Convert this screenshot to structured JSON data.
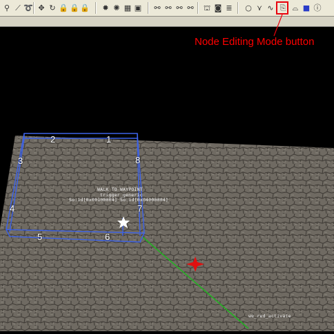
{
  "toolbar": {
    "buttons": [
      {
        "icon": "select-icon",
        "glyph": "⚲"
      },
      {
        "icon": "wand-icon",
        "glyph": "⟋"
      },
      {
        "icon": "lasso-icon",
        "glyph": "➰"
      },
      {
        "icon": "move-icon",
        "glyph": "✥"
      },
      {
        "icon": "rotate-icon",
        "glyph": "↻"
      },
      {
        "icon": "lock-icon",
        "glyph": "🔒"
      },
      {
        "icon": "lock-2-icon",
        "glyph": "🔒"
      },
      {
        "icon": "lock-3-icon",
        "glyph": "🔒"
      },
      {
        "icon": "sun-icon",
        "glyph": "✹"
      },
      {
        "icon": "light-icon",
        "glyph": "✺"
      },
      {
        "icon": "grid-icon",
        "glyph": "▦"
      },
      {
        "icon": "picture-icon",
        "glyph": "▣"
      },
      {
        "icon": "link-icon",
        "glyph": "⚯"
      },
      {
        "icon": "node-link-icon",
        "glyph": "⚯"
      },
      {
        "icon": "node-link-2-icon",
        "glyph": "⚯"
      },
      {
        "icon": "node-link-3-icon",
        "glyph": "⚯"
      },
      {
        "icon": "object-icon",
        "glyph": "⛫"
      },
      {
        "icon": "camera-icon",
        "glyph": "◙"
      },
      {
        "icon": "layers-icon",
        "glyph": "≣"
      },
      {
        "icon": "circle-icon",
        "glyph": "○"
      },
      {
        "icon": "path-icon",
        "glyph": "⋎"
      },
      {
        "icon": "spline-icon",
        "glyph": "∿"
      },
      {
        "icon": "node-editing-mode-icon",
        "glyph": "⎘"
      },
      {
        "icon": "brush-icon",
        "glyph": "⌓"
      },
      {
        "icon": "color-swatch-icon",
        "glyph": "■"
      },
      {
        "icon": "info-icon",
        "glyph": "ⓘ"
      }
    ]
  },
  "annotation": {
    "label": "Node Editing Mode button",
    "color": "#ff0000"
  },
  "scene": {
    "corner_numbers": [
      "1",
      "2",
      "3",
      "4",
      "5",
      "6",
      "7",
      "8"
    ],
    "entity_label": {
      "line1": "WALK TO WAYPOINT",
      "line2": "trigger_generic",
      "line3": "So:id[0x00100004] So:id[0x04000004]"
    },
    "target_label": "we_red_activate",
    "colors": {
      "volume_box": "#3c62e8",
      "link_line": "#22b422",
      "target_marker": "#e01010",
      "waypoint_marker": "#ffffff",
      "floor": "#6f6a62",
      "sky": "#000000"
    }
  }
}
